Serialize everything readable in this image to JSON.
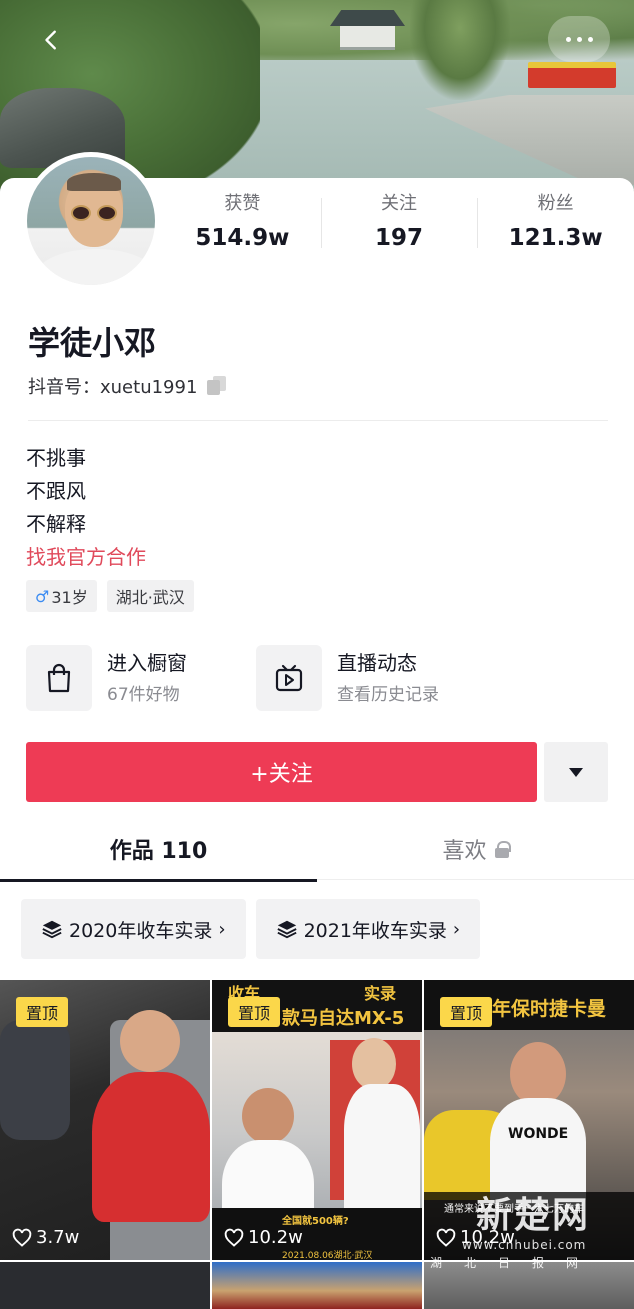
{
  "header": {
    "back_icon": "chevron-left-icon",
    "more_icon": "more-dots-icon"
  },
  "profile": {
    "name": "学徒小邓",
    "douyin_id": "抖音号：xuetu1991",
    "stats": [
      {
        "label": "获赞",
        "value": "514.9w"
      },
      {
        "label": "关注",
        "value": "197"
      },
      {
        "label": "粉丝",
        "value": "121.3w"
      }
    ],
    "bio": [
      "不挑事",
      "不跟风",
      "不解释"
    ],
    "bio_link": "找我官方合作",
    "tags": {
      "gender_symbol": "♂",
      "age": "31岁",
      "location": "湖北·武汉"
    }
  },
  "features": [
    {
      "title": "进入橱窗",
      "subtitle": "67件好物",
      "icon": "shopping-bag-icon"
    },
    {
      "title": "直播动态",
      "subtitle": "查看历史记录",
      "icon": "tv-play-icon"
    }
  ],
  "actions": {
    "follow_label": "+关注",
    "dropdown_icon": "caret-down-icon"
  },
  "tabs": [
    {
      "label": "作品 110",
      "active": true
    },
    {
      "label": "喜欢",
      "locked": true
    }
  ],
  "collections": [
    {
      "label": "2020年收车实录",
      "icon": "stack-icon"
    },
    {
      "label": "2021年收车实录",
      "icon": "stack-icon"
    }
  ],
  "videos": [
    {
      "pinned_label": "置顶",
      "likes": "3.7w"
    },
    {
      "pinned_label": "置顶",
      "likes": "10.2w",
      "overlay_text": "款马自达MX-5",
      "overlay_top": "收车",
      "overlay_top2": "实录",
      "caption": "全国就500辆?",
      "caption_date": "2021.08.06湖北·武汉"
    },
    {
      "pinned_label": "置顶",
      "likes": "10.2w",
      "overlay_text": "年保时捷卡曼",
      "shirt_text": "WONDE",
      "caption": "通常来说不要到手一六七万的车"
    }
  ],
  "watermark": {
    "text": "新楚网",
    "url": "www.cnhubei.com",
    "small": "湖北日报网"
  },
  "colors": {
    "accent": "#ee3b55",
    "link": "#e04a5b",
    "pin": "#fbd74a"
  }
}
